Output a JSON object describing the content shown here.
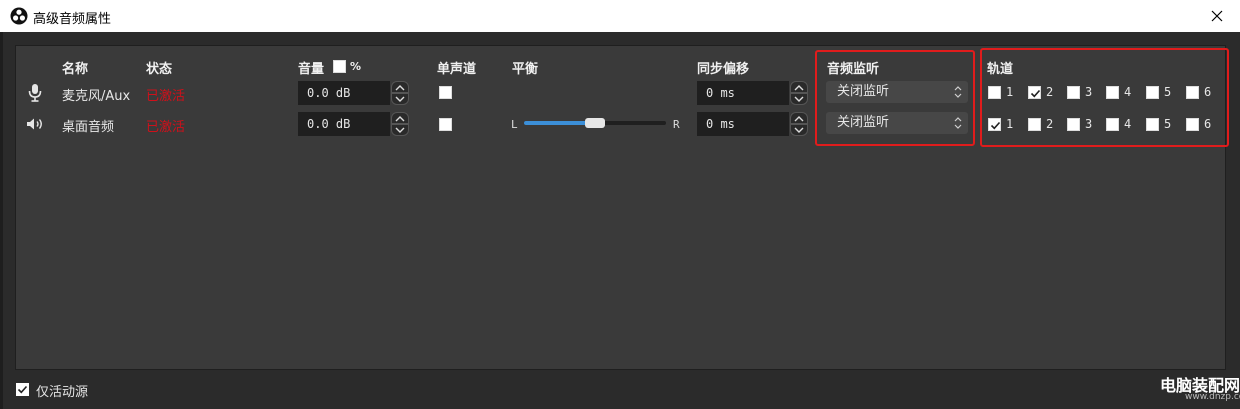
{
  "window": {
    "title": "高级音频属性"
  },
  "headers": {
    "name": "名称",
    "status": "状态",
    "volume": "音量",
    "volume_percent": "%",
    "mono": "单声道",
    "balance": "平衡",
    "sync_offset": "同步偏移",
    "monitoring": "音频监听",
    "tracks": "轨道"
  },
  "rows": [
    {
      "icon": "microphone-icon",
      "name": "麦克风/Aux",
      "status": "已激活",
      "volume": "0.0 dB",
      "mono": false,
      "balance_visible": false,
      "sync": "0 ms",
      "monitoring": "关闭监听",
      "tracks": [
        {
          "num": "1",
          "checked": false
        },
        {
          "num": "2",
          "checked": true
        },
        {
          "num": "3",
          "checked": false
        },
        {
          "num": "4",
          "checked": false
        },
        {
          "num": "5",
          "checked": false
        },
        {
          "num": "6",
          "checked": false
        }
      ]
    },
    {
      "icon": "speaker-icon",
      "name": "桌面音频",
      "status": "已激活",
      "volume": "0.0 dB",
      "mono": false,
      "balance_visible": true,
      "balance_left": "L",
      "balance_right": "R",
      "balance_value": 0.5,
      "sync": "0 ms",
      "monitoring": "关闭监听",
      "tracks": [
        {
          "num": "1",
          "checked": true
        },
        {
          "num": "2",
          "checked": false
        },
        {
          "num": "3",
          "checked": false
        },
        {
          "num": "4",
          "checked": false
        },
        {
          "num": "5",
          "checked": false
        },
        {
          "num": "6",
          "checked": false
        }
      ]
    }
  ],
  "footer": {
    "active_only_label": "仅活动源",
    "active_only_checked": true
  },
  "watermark": {
    "main": "电脑装配网",
    "sub": "www.dnzp.com"
  },
  "colors": {
    "status": "#d0101a",
    "highlight_box": "#e01c1c",
    "slider_fill": "#3c8fd8"
  }
}
